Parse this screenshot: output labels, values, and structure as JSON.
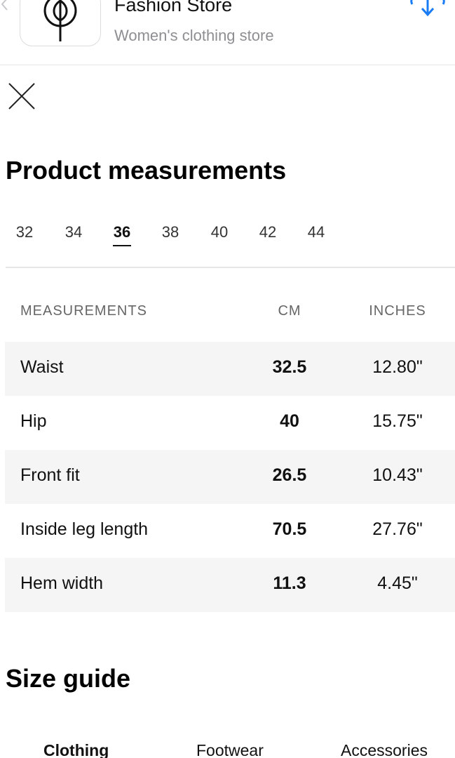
{
  "app_banner": {
    "name": "Fashion Store",
    "subtitle": "Women's clothing store"
  },
  "title": "Product measurements",
  "sizes": {
    "items": [
      "32",
      "34",
      "36",
      "38",
      "40",
      "42",
      "44"
    ],
    "selected": "36"
  },
  "table": {
    "headers": {
      "label": "MEASUREMENTS",
      "cm": "CM",
      "inches": "INCHES"
    },
    "rows": [
      {
        "label": "Waist",
        "cm": "32.5",
        "inches": "12.80\""
      },
      {
        "label": "Hip",
        "cm": "40",
        "inches": "15.75\""
      },
      {
        "label": "Front fit",
        "cm": "26.5",
        "inches": "10.43\""
      },
      {
        "label": "Inside leg length",
        "cm": "70.5",
        "inches": "27.76\""
      },
      {
        "label": "Hem width",
        "cm": "11.3",
        "inches": "4.45\""
      }
    ]
  },
  "size_guide": {
    "title": "Size guide",
    "tabs": [
      "Clothing",
      "Footwear",
      "Accessories"
    ],
    "selected": "Clothing"
  },
  "colors": {
    "accent_blue": "#1a7cf5",
    "row_shade": "#f5f5f5"
  }
}
